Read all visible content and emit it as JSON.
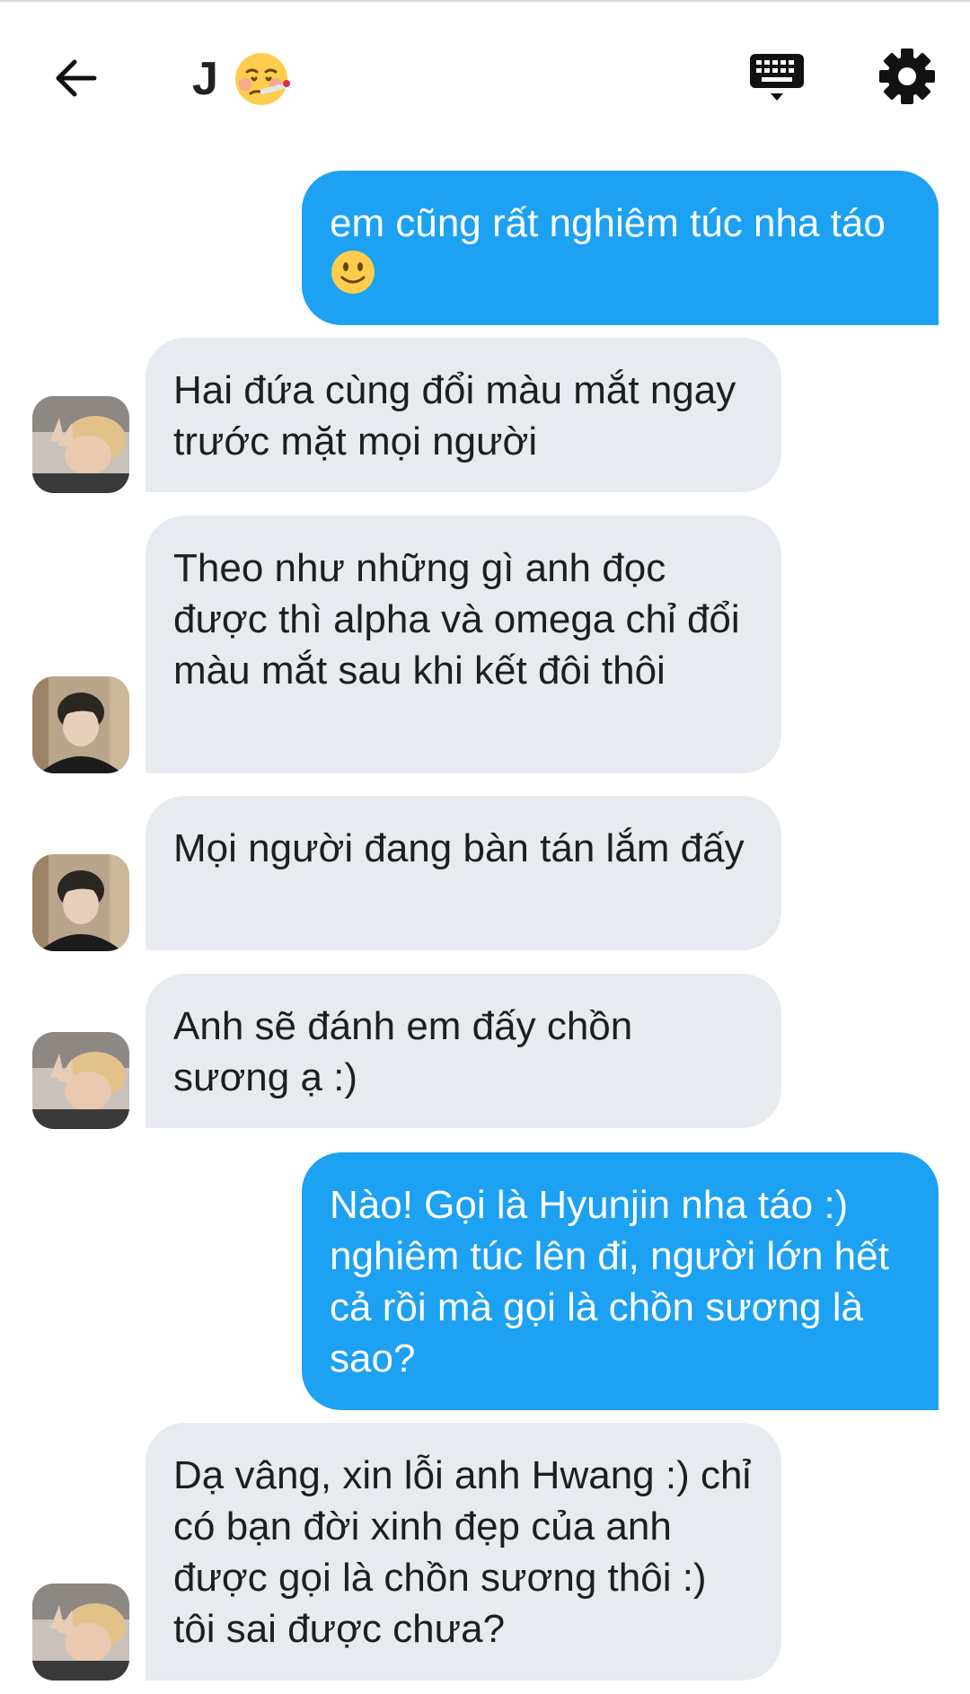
{
  "header": {
    "title": "J",
    "title_emoji": "face-with-thermometer-emoji",
    "back_icon": "arrow-left-icon",
    "keyboard_icon": "keyboard-icon",
    "settings_icon": "gear-icon"
  },
  "messages": [
    {
      "sender": "me",
      "text": "em cũng rất nghiêm túc nha táo",
      "emoji": "slightly-smiling-face-emoji"
    },
    {
      "sender": "blond",
      "text": "Hai đứa cùng đổi màu mắt ngay trước mặt mọi người"
    },
    {
      "sender": "dark",
      "text": "Theo như những gì anh đọc được thì alpha và omega chỉ đổi màu mắt sau khi kết đôi thôi"
    },
    {
      "sender": "dark",
      "text": "Mọi người đang bàn tán lắm đấy"
    },
    {
      "sender": "blond",
      "text": "Anh sẽ đánh em đấy chồn sương ạ :)"
    },
    {
      "sender": "me",
      "text": "Nào! Gọi là Hyunjin nha táo :) nghiêm túc lên đi, người lớn hết cả rồi mà gọi là chồn sương là sao?"
    },
    {
      "sender": "blond",
      "text": "Dạ vâng, xin lỗi anh Hwang :) chỉ có bạn đời xinh đẹp của anh được gọi là chồn sương thôi :) tôi sai được chưa?"
    }
  ],
  "colors": {
    "outgoing_bubble": "#1da1f2",
    "incoming_bubble": "#e7ebef",
    "text_dark": "#1e1e1e"
  }
}
